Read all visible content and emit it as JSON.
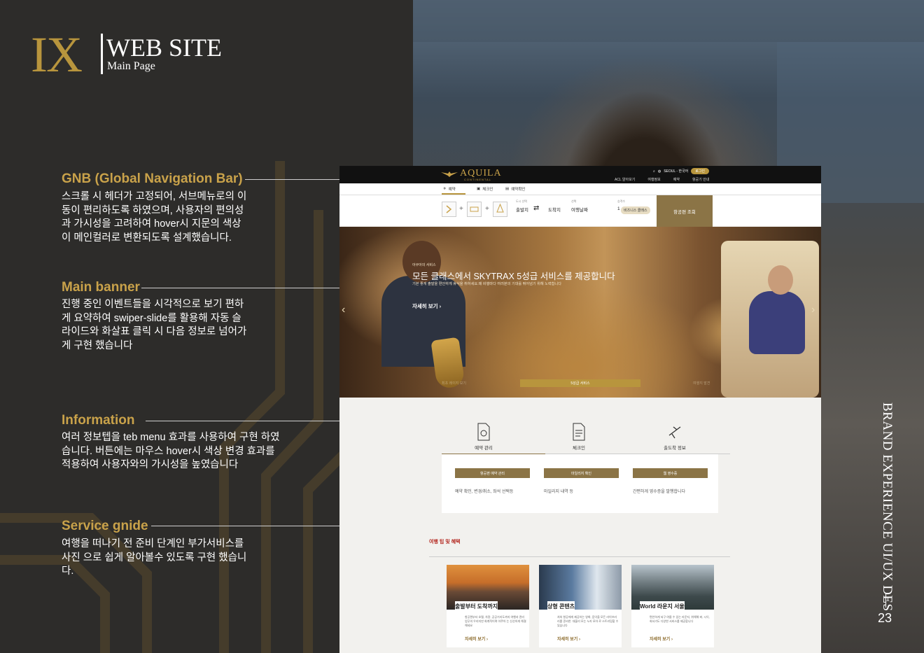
{
  "slide": {
    "logo_mark": "IX",
    "title": "WEB SITE",
    "subtitle": "Main Page",
    "vertical_text": "BRAND EXPERIENCE UI/UX DES",
    "page_number": "23"
  },
  "annotations": [
    {
      "title": "GNB (Global Navigation Bar)",
      "text": "스크롤 시 헤더가 고정되어, 서브메뉴로의 이동이 편리하도록 하였으며, 사용자의 편의성과 가시성을 고려하여 hover시 지문의 색상이 메인컬러로 변환되도록 설계했습니다."
    },
    {
      "title": "Main banner",
      "text": "진행 중인 이벤트들을 시각적으로 보기 편하게 요약하여 swiper-slide를 활용해 자동 슬라이드와 화살표 클릭 시 다음 정보로 넘어가게 구현 했습니다"
    },
    {
      "title": "Information",
      "text": "여러 정보텝을 teb menu 효과를 사용하여 구현 하였습니다. 버튼에는 마우스 hover시 색상 변경 효과를 적용하여 사용자와의 가시성을 높였습니다"
    },
    {
      "title": "Service gnide",
      "text": "여행을 떠나기 전 준비 단계인 부가서비스를 사진 으로 쉽게 알아볼수 있도록 구현 했습니다."
    }
  ],
  "site": {
    "brand": "AQUILA",
    "brand_sub": "CONTINENTAL",
    "util": {
      "location": "SEOUL - 한국어",
      "login": "로그인"
    },
    "menu": [
      "ACL 알아보기",
      "여행정보",
      "예약",
      "항공기 안내"
    ],
    "tabs": [
      "예약",
      "체크인",
      "예약확인"
    ],
    "booking": {
      "trip_types": [
        "편도/왕복",
        "다구간",
        "Stopover 프로그램"
      ],
      "city_label": "도시 선택",
      "from": "출발지",
      "to": "도착지",
      "date_label": "선택",
      "date": "여행날짜",
      "pax_label": "승객수",
      "pax": "1",
      "cabin": "비즈니스 클래스",
      "search": "항공편 조회"
    },
    "banner": {
      "eyebrow": "아쿠아의 서비스",
      "headline": "모든 클래스에서 SKYTRAX 5성급 서비스를 제공합니다",
      "desc": "기본 좋게 출발을 편안하게 휴식을 취하세요.매 비행마다 여러분의 기대를 뛰어넘기 위해 노력합니다",
      "more": "자세히 보기",
      "pagination": [
        "최초 레이지 보기",
        "5성급 서비스",
        "여행지 발견"
      ],
      "prev": "‹",
      "next": "›"
    },
    "info": {
      "tabs": [
        "예약 관리",
        "체크인",
        "출도착 정보"
      ],
      "buttons": [
        "항공편 예약 관리",
        "마일리지 확인",
        "웹 영수증"
      ],
      "texts": [
        "예약 확인, 변경/취소, 좌석 선택등",
        "마일리지 내역 등",
        "간편하게 영수증을 발행합니다"
      ]
    },
    "service": {
      "title": "여행 팁 및 혜택",
      "cards": [
        {
          "name": "출발부터 도착까지",
          "desc": "항공편부터 호텔, 차량, 공공거리도까지 여행과 관리업무의 우리지만 회계적이며 아쿠아 는 신산하게 해결해세요",
          "more": "자세히 보기"
        },
        {
          "name": "상형 콘텐츠",
          "desc": "처처 항공에게 제공하는 영화, 음악을 모든 라이브러리를 준비한. 대불리 모는 누카 모아 로 스트리밍할 수 있습니다",
          "more": "자세히 보기"
        },
        {
          "name": "World 라운지 서울",
          "desc": "편안하게 되구 여름 수 있는 라운지, 위해해 봐, 시익, 회서기도 다양한 서비스를 제공합니다",
          "more": "자세히 보기"
        }
      ]
    }
  },
  "colors": {
    "accent_gold": "#b8953d",
    "panel": "#2d2c2a",
    "button_brown": "#8b7446"
  }
}
